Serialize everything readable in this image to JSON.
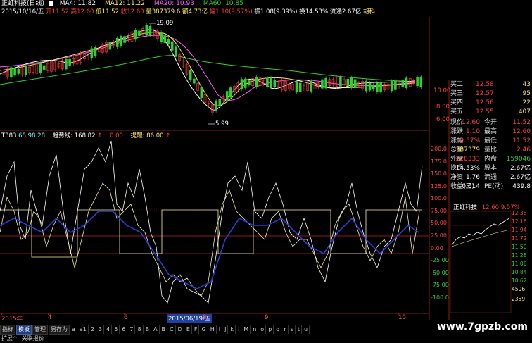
{
  "window": {
    "title": "正虹科技(日线)"
  },
  "ma_bar": {
    "ma4": "MA4: 11.82",
    "ma12": "MA12: 11.22",
    "ma20": "MA20: 10.93",
    "ma60": "MA60: 10.85"
  },
  "quote_bar": {
    "date": "2015/10/16/五",
    "open": "开11.52",
    "high": "高12.60",
    "low": "低11.52",
    "close": "收12.60",
    "volume": "量387379.6",
    "amount": "额4.73亿",
    "pct": "幅1.10(9.57%)",
    "swing": "振1.08(9.39%)",
    "turnover": "换14.53%",
    "float": "流通2.67亿",
    "extra": "胡科"
  },
  "price_axis": {
    "labels": [
      "10.00",
      "8.00",
      "6.00"
    ]
  },
  "price_annotations": {
    "high": "19.09",
    "low": "5.99"
  },
  "indicator": {
    "code": "T383",
    "item1_label": "68.98.28",
    "trend_label": "趋势线: 168.82",
    "up_arrow": "↑",
    "zero_label": "0.00",
    "prompt_label": "提醒: 86.00",
    "axis": [
      "200.0",
      "175.0",
      "150.0",
      "125.0",
      "100.0",
      "75.00",
      "50.00",
      "25.00",
      "0.00",
      "-25.00",
      "-50.00",
      "-75.00",
      "-100.0"
    ]
  },
  "colors": {
    "up": "#ff3c3c",
    "down": "#2fd02f",
    "ma4": "#ffffff",
    "ma12": "#ffe860",
    "ma20": "#ff60ff",
    "ma60": "#2fd02f",
    "blue": "#2b3bd6",
    "grid": "#8b1a1a"
  },
  "panel": {
    "asks": [
      {
        "label": "买二",
        "price": "12.58",
        "vol": "43"
      },
      {
        "label": "买三",
        "price": "12.57",
        "vol": "95"
      },
      {
        "label": "买四",
        "price": "12.56",
        "vol": "22"
      },
      {
        "label": "买五",
        "price": "12.55",
        "vol": "407"
      }
    ],
    "rows": [
      {
        "l1": "现价",
        "v1": "12.60",
        "l2": "今开",
        "v2": "11.52"
      },
      {
        "l1": "涨跌",
        "v1": "1.10",
        "l2": "最高",
        "v2": "12.60"
      },
      {
        "l1": "涨幅",
        "v1": "9.57%",
        "l2": "最低",
        "v2": "11.52"
      },
      {
        "l1": "总量",
        "v1": "387379",
        "l2": "量比",
        "v2": "2.46"
      },
      {
        "l1": "外盘",
        "v1": "228333",
        "l2": "内盘",
        "v2": "159046"
      },
      {
        "l1": "换手",
        "v1": "14.53%",
        "l2": "股本",
        "v2": "2.67亿"
      },
      {
        "l1": "净资",
        "v1": "1.76",
        "l2": "流通",
        "v2": "2.67亿"
      },
      {
        "l1": "收益(三)",
        "v1": "0.014",
        "l2": "PE(动)",
        "v2": "439.8"
      }
    ],
    "mini_title": "正虹科技",
    "mini_price": "12.60 9.57%",
    "mini_axis": [
      "12.38",
      "12.16",
      "11.94",
      "11.72",
      "11.50",
      "11.28",
      "11.06",
      "10.84",
      "10.62"
    ],
    "mini_vol_axis": [
      "4506",
      "2359"
    ]
  },
  "time_axis": {
    "labels": [
      "2015年",
      "4",
      "6",
      "2015/06/19/五",
      "8",
      "9",
      "10"
    ]
  },
  "toolbar": {
    "items": [
      "指标",
      "模板",
      "管理",
      "另存为",
      "a",
      "a1",
      "2",
      "3",
      "4",
      "5",
      "6",
      "7",
      "8",
      "B",
      "A",
      "B",
      "C",
      "D",
      "E",
      "F",
      "G",
      "H",
      "I",
      "J",
      "k",
      "l",
      "M",
      "n",
      "o",
      "p",
      "q",
      "r",
      "s",
      "t",
      "u"
    ],
    "selected": "模板"
  },
  "taskbar": {
    "items": [
      "扩展^",
      "关联报价"
    ]
  },
  "watermark": "www.7gpzb.com"
}
